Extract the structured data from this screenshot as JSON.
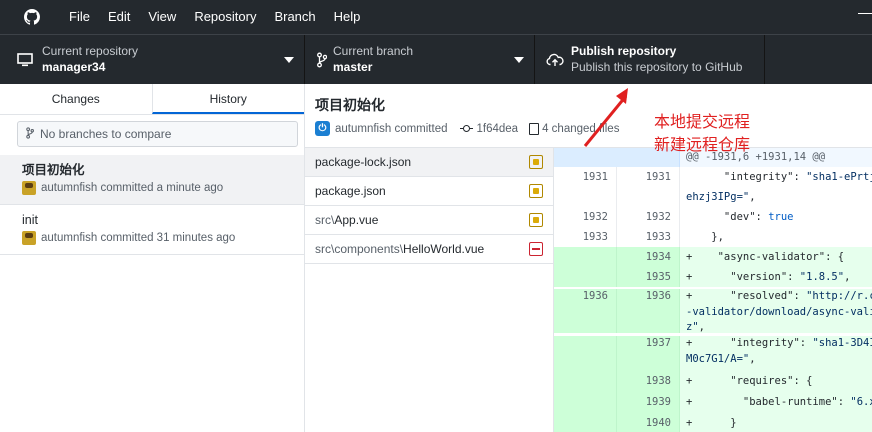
{
  "menu": {
    "items": [
      "File",
      "Edit",
      "View",
      "Repository",
      "Branch",
      "Help"
    ]
  },
  "toolbar": {
    "repo_title": "Current repository",
    "repo_value": "manager34",
    "branch_title": "Current branch",
    "branch_value": "master",
    "publish_title": "Publish repository",
    "publish_value": "Publish this repository to GitHub"
  },
  "sidebar": {
    "tabs": [
      "Changes",
      "History"
    ],
    "selected_tab": "History",
    "branch_placeholder": "No branches to compare",
    "commits": [
      {
        "title": "项目初始化",
        "meta": "autumnfish committed a minute ago"
      },
      {
        "title": "init",
        "meta": "autumnfish committed 31 minutes ago"
      }
    ]
  },
  "commit": {
    "title": "项目初始化",
    "author": "autumnfish committed",
    "sha": "1f64dea",
    "changed": "4 changed files"
  },
  "files": [
    {
      "dir": "",
      "name": "package-lock.json",
      "status": "modified"
    },
    {
      "dir": "",
      "name": "package.json",
      "status": "modified"
    },
    {
      "dir": "src\\",
      "name": "App.vue",
      "status": "modified"
    },
    {
      "dir": "src\\components\\",
      "name": "HelloWorld.vue",
      "status": "deleted"
    }
  ],
  "diff": {
    "hunk": "@@ -1931,6 +1931,14 @@"
  },
  "annotation": {
    "line1": "本地提交远程",
    "line2": "新建远程仓库",
    "color": "#e02020"
  }
}
